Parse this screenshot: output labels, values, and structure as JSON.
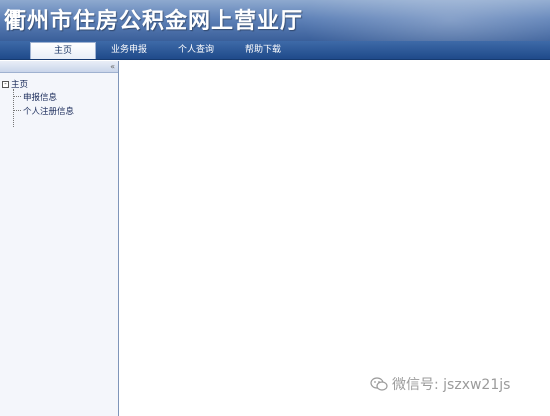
{
  "banner": {
    "title": "衢州市住房公积金网上营业厅"
  },
  "nav": {
    "tabs": [
      {
        "label": "主页",
        "active": true
      },
      {
        "label": "业务申报",
        "active": false
      },
      {
        "label": "个人查询",
        "active": false
      },
      {
        "label": "帮助下载",
        "active": false
      }
    ]
  },
  "sidebar": {
    "collapse_glyph": "«",
    "tree": {
      "root": {
        "label": "主页",
        "toggle": "-"
      },
      "children": [
        {
          "label": "申报信息"
        },
        {
          "label": "个人注册信息"
        }
      ]
    }
  },
  "watermark": {
    "text": "微信号: jszxw21js"
  },
  "colors": {
    "banner_top": "#8ea9cf",
    "banner_bottom": "#3a5f9a",
    "nav_bg": "#1f4a8a",
    "sidebar_bg": "#f4f6fb"
  },
  "icons": {
    "collapse": "double-chevron-left-icon",
    "tree_toggle": "minus-box-icon",
    "wechat": "wechat-icon"
  }
}
